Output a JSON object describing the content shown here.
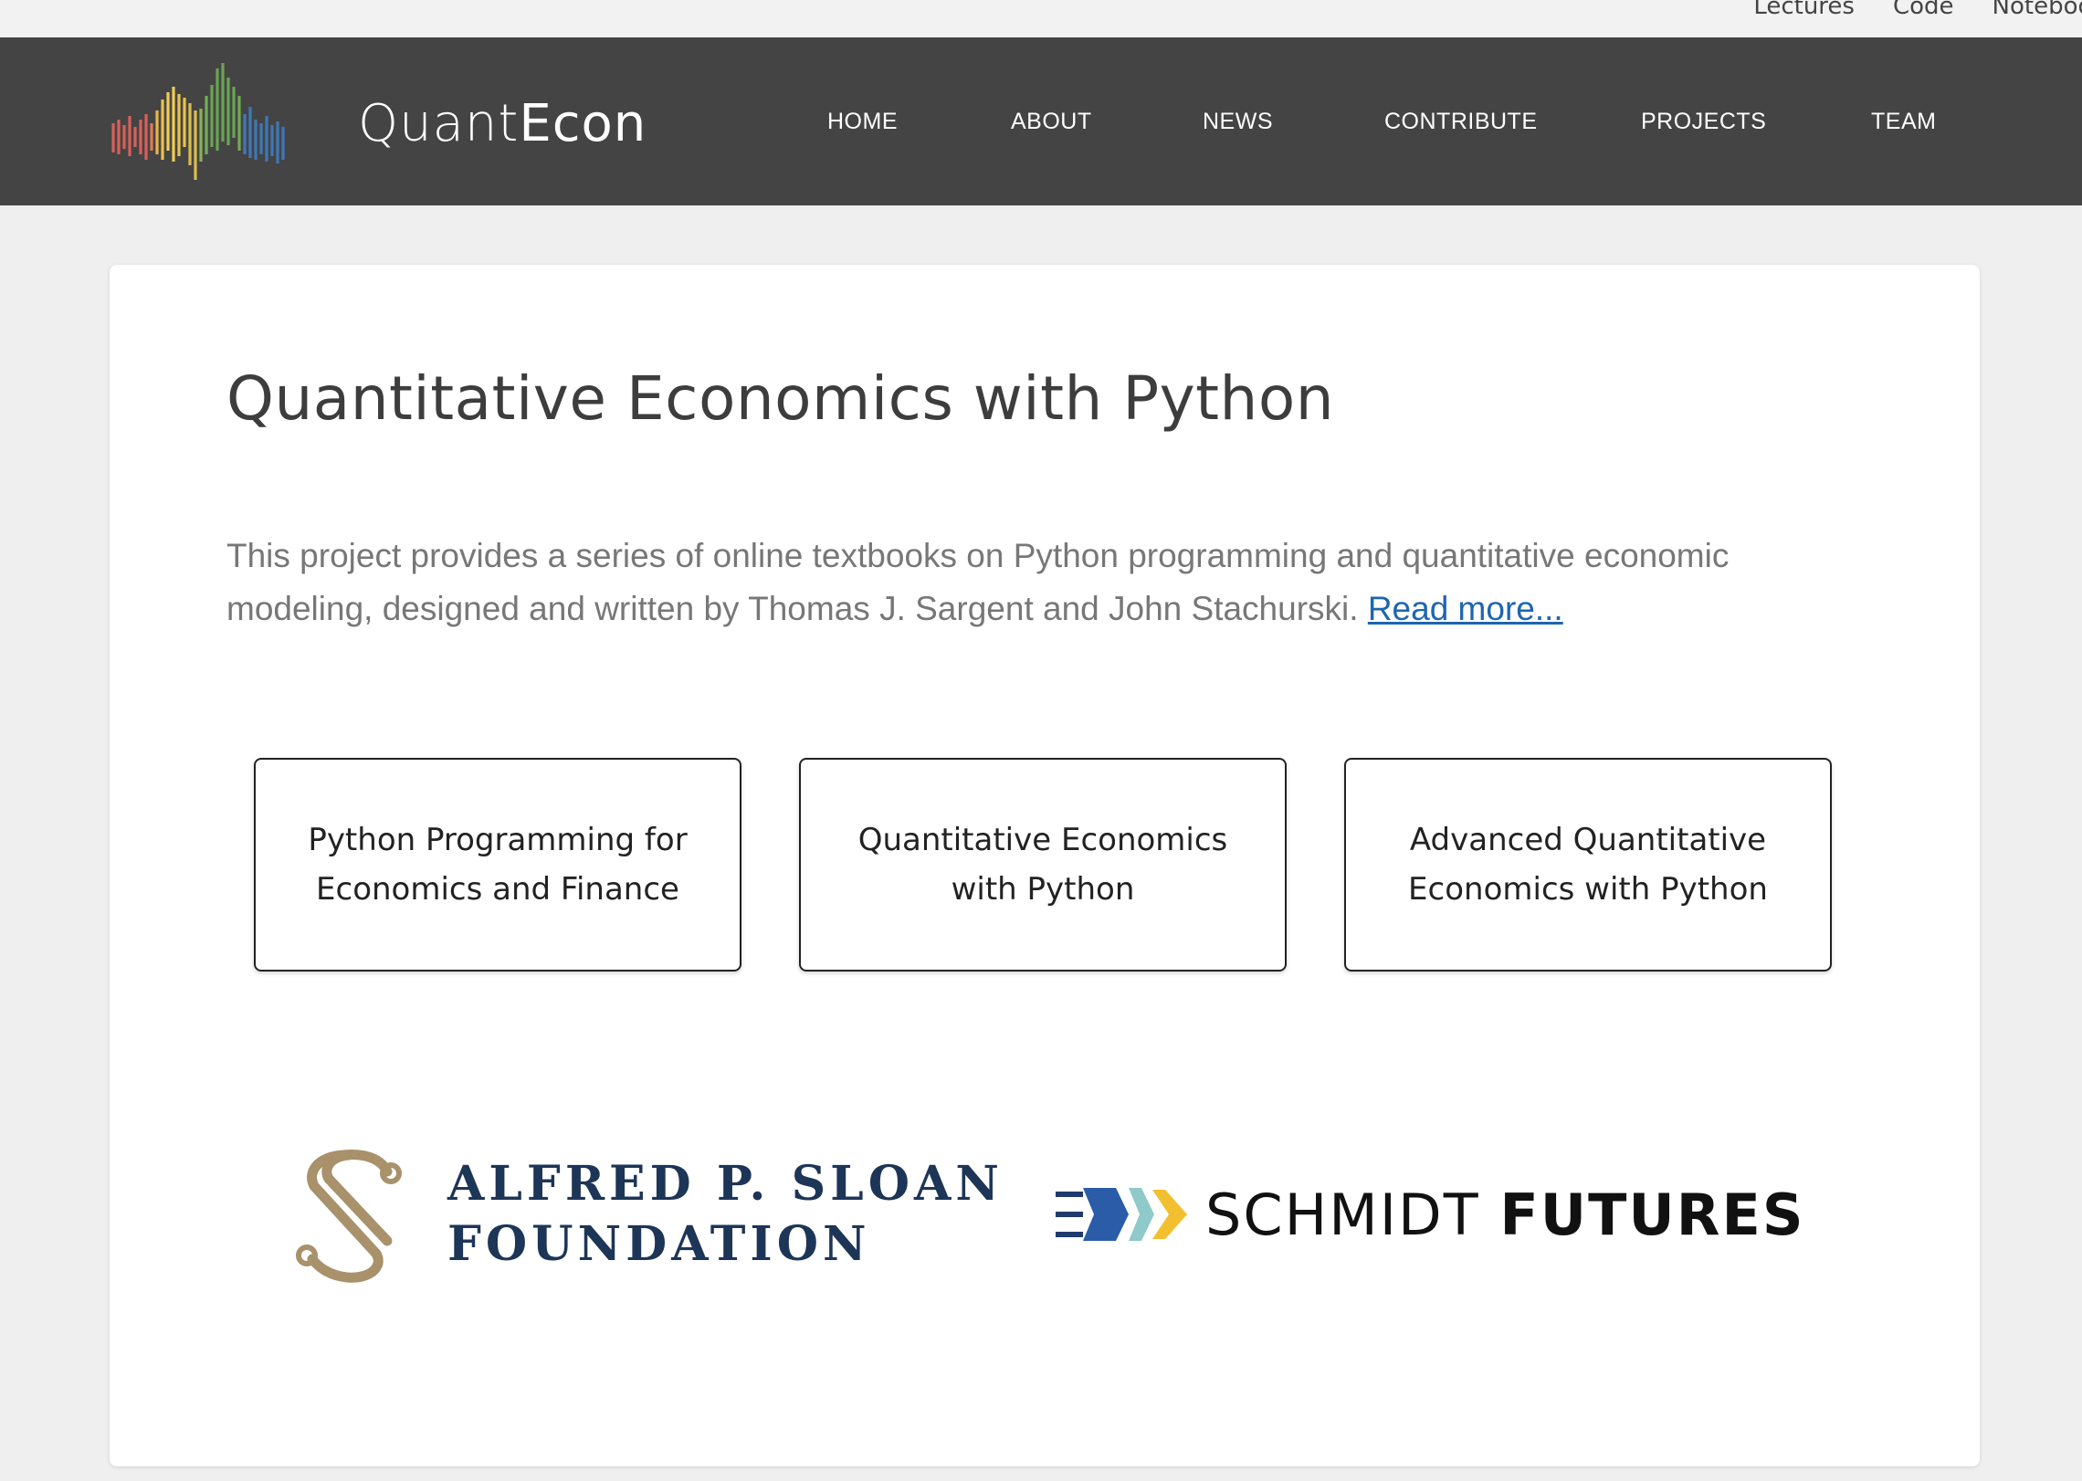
{
  "utility_bar": {
    "links": [
      "Lectures",
      "Code",
      "Notebooks"
    ]
  },
  "header": {
    "logo": {
      "text_quant": "Quant",
      "text_econ": "Econ"
    },
    "nav": [
      "HOME",
      "ABOUT",
      "NEWS",
      "CONTRIBUTE",
      "PROJECTS",
      "TEAM"
    ]
  },
  "main": {
    "title": "Quantitative Economics with Python",
    "intro": "This project provides a series of online textbooks on Python programming and quantitative economic modeling, designed and written by Thomas J. Sargent and John Stachurski.",
    "read_more": "Read more...",
    "books": [
      "Python Programming for Economics and Finance",
      "Quantitative Economics with Python",
      "Advanced Quantitative Economics with Python"
    ]
  },
  "sponsors": {
    "sloan": {
      "line1": "ALFRED P. SLOAN",
      "line2": "FOUNDATION",
      "color": "#1d3557",
      "mark_color": "#a8916b"
    },
    "schmidt": {
      "word1": "SCHMIDT",
      "word2": "FUTURES"
    }
  },
  "colors": {
    "navbar": "#444444",
    "link": "#1e65b0",
    "background": "#efefef"
  }
}
